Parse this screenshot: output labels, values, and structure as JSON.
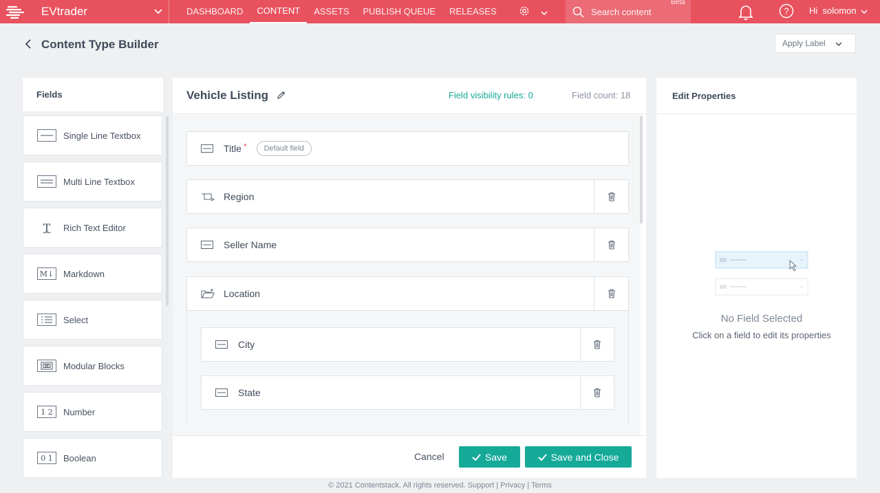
{
  "topbar": {
    "brand": "EVtrader",
    "tabs": [
      {
        "label": "DASHBOARD",
        "active": false
      },
      {
        "label": "CONTENT",
        "active": true
      },
      {
        "label": "ASSETS",
        "active": false
      },
      {
        "label": "PUBLISH QUEUE",
        "active": false
      },
      {
        "label": "RELEASES",
        "active": false
      }
    ],
    "search_placeholder": "Search content",
    "beta": "Beta",
    "user_greeting": "Hi  solomon"
  },
  "page": {
    "title": "Content Type Builder",
    "apply_label": "Apply Label"
  },
  "fields_panel": {
    "heading": "Fields",
    "items": [
      {
        "label": "Single Line Textbox",
        "icon": "single-line-icon",
        "glyph": ""
      },
      {
        "label": "Multi Line Textbox",
        "icon": "multi-line-icon",
        "glyph": ""
      },
      {
        "label": "Rich Text Editor",
        "icon": "rich-text-icon",
        "glyph": "T"
      },
      {
        "label": "Markdown",
        "icon": "markdown-icon",
        "glyph": "M↓"
      },
      {
        "label": "Select",
        "icon": "select-icon",
        "glyph": ""
      },
      {
        "label": "Modular Blocks",
        "icon": "modular-blocks-icon",
        "glyph": ""
      },
      {
        "label": "Number",
        "icon": "number-icon",
        "glyph": "1 2"
      },
      {
        "label": "Boolean",
        "icon": "boolean-icon",
        "glyph": "0 1"
      }
    ]
  },
  "builder": {
    "content_type_name": "Vehicle Listing",
    "visibility_rules": "Field visibility rules: 0",
    "field_count": "Field count: 18",
    "fields": {
      "title": {
        "label": "Title",
        "required_mark": "*",
        "badge": "Default field"
      },
      "region": {
        "label": "Region"
      },
      "seller_name": {
        "label": "Seller Name"
      },
      "location": {
        "label": "Location"
      },
      "city": {
        "label": "City"
      },
      "state": {
        "label": "State"
      }
    },
    "cancel": "Cancel",
    "save": "Save",
    "save_close": "Save and Close"
  },
  "properties": {
    "heading": "Edit Properties",
    "empty_title": "No Field Selected",
    "empty_sub": "Click on a field to edit its properties"
  },
  "footer": {
    "text": "© 2021 Contentstack. All rights reserved. Support | Privacy | Terms"
  },
  "colors": {
    "topbar": "#e8525f",
    "accent": "#15a998"
  }
}
